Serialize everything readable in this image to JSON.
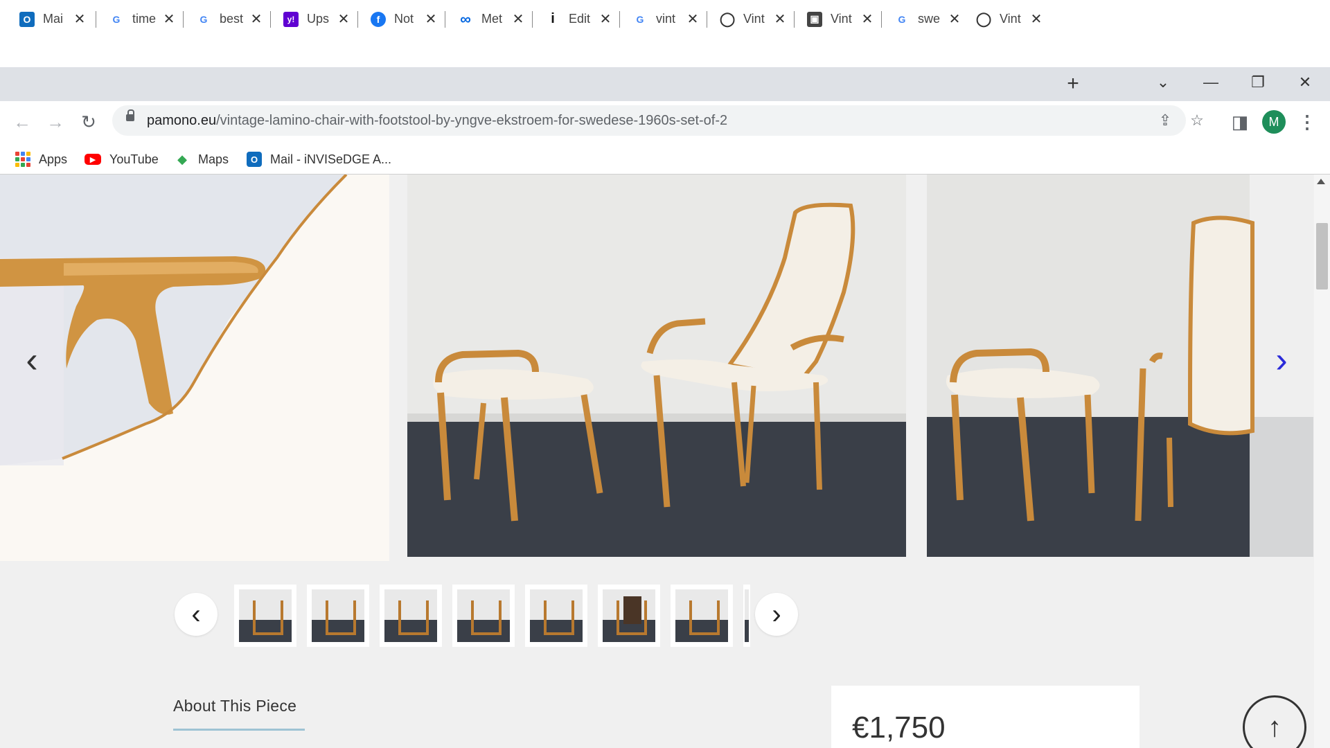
{
  "browser": {
    "tabs": [
      {
        "favicon": "outlook-icon",
        "title": "Mai",
        "fav_bg": "#0f6cbd",
        "fav_fg": "#ffffff",
        "fav_text": "O"
      },
      {
        "favicon": "google-icon",
        "title": "time",
        "fav_bg": "#ffffff",
        "fav_fg": "#4285f4",
        "fav_text": "G"
      },
      {
        "favicon": "google-icon",
        "title": "best",
        "fav_bg": "#ffffff",
        "fav_fg": "#4285f4",
        "fav_text": "G"
      },
      {
        "favicon": "yahoo-icon",
        "title": "Ups",
        "fav_bg": "#6001d2",
        "fav_fg": "#ffffff",
        "fav_text": "y!"
      },
      {
        "favicon": "facebook-icon",
        "title": "Not",
        "fav_bg": "#1877f2",
        "fav_fg": "#ffffff",
        "fav_text": "f"
      },
      {
        "favicon": "meta-icon",
        "title": "Met",
        "fav_bg": "#ffffff",
        "fav_fg": "#0668e1",
        "fav_text": "∞"
      },
      {
        "favicon": "info-icon",
        "title": "Edit",
        "fav_bg": "#ffffff",
        "fav_fg": "#111111",
        "fav_text": "i"
      },
      {
        "favicon": "google-icon",
        "title": "vint",
        "fav_bg": "#ffffff",
        "fav_fg": "#4285f4",
        "fav_text": "G"
      },
      {
        "favicon": "globe-icon",
        "title": "Vint",
        "fav_bg": "#ffffff",
        "fav_fg": "#333333",
        "fav_text": "◯"
      },
      {
        "favicon": "site-icon",
        "title": "Vint",
        "fav_bg": "#444444",
        "fav_fg": "#ffffff",
        "fav_text": "▣"
      },
      {
        "favicon": "google-icon",
        "title": "swe",
        "fav_bg": "#ffffff",
        "fav_fg": "#4285f4",
        "fav_text": "G"
      },
      {
        "favicon": "globe-icon",
        "title": "Vint",
        "fav_bg": "#ffffff",
        "fav_fg": "#333333",
        "fav_text": "◯",
        "active": true
      }
    ],
    "close_glyph": "✕",
    "new_tab_glyph": "+",
    "window_controls": {
      "dropdown": "⌄",
      "minimize": "—",
      "restore": "❐",
      "close": "✕"
    },
    "nav": {
      "back": "←",
      "forward": "→",
      "reload": "↻"
    },
    "url_domain": "pamono.eu",
    "url_path": "/vintage-lamino-chair-with-footstool-by-yngve-ekstroem-for-swedese-1960s-set-of-2",
    "omnibox_icons": {
      "share": "⇪",
      "star": "☆"
    },
    "side_panel_icon": "◨",
    "profile_initial": "M",
    "menu_glyph": "⋮",
    "bookmarks": [
      {
        "label": "Apps",
        "icon": "apps-grid-icon"
      },
      {
        "label": "YouTube",
        "icon": "youtube-icon",
        "glyph": "▶"
      },
      {
        "label": "Maps",
        "icon": "maps-icon",
        "glyph": "◆"
      },
      {
        "label": "Mail - iNVISeDGE A...",
        "icon": "outlook-icon",
        "glyph": "O"
      }
    ]
  },
  "page": {
    "gallery": {
      "prev_glyph": "‹",
      "next_glyph": "›"
    },
    "thumbnails": {
      "prev_glyph": "‹",
      "next_glyph": "›",
      "count": 7
    },
    "about_title": "About This Piece",
    "price": "€1,750",
    "back_to_top_glyph": "↑"
  },
  "colors": {
    "accent_arrow": "#2b2bd9",
    "about_underline": "#9ec3d4",
    "wood": "#c98a3b",
    "floor": "#3a3f48"
  }
}
